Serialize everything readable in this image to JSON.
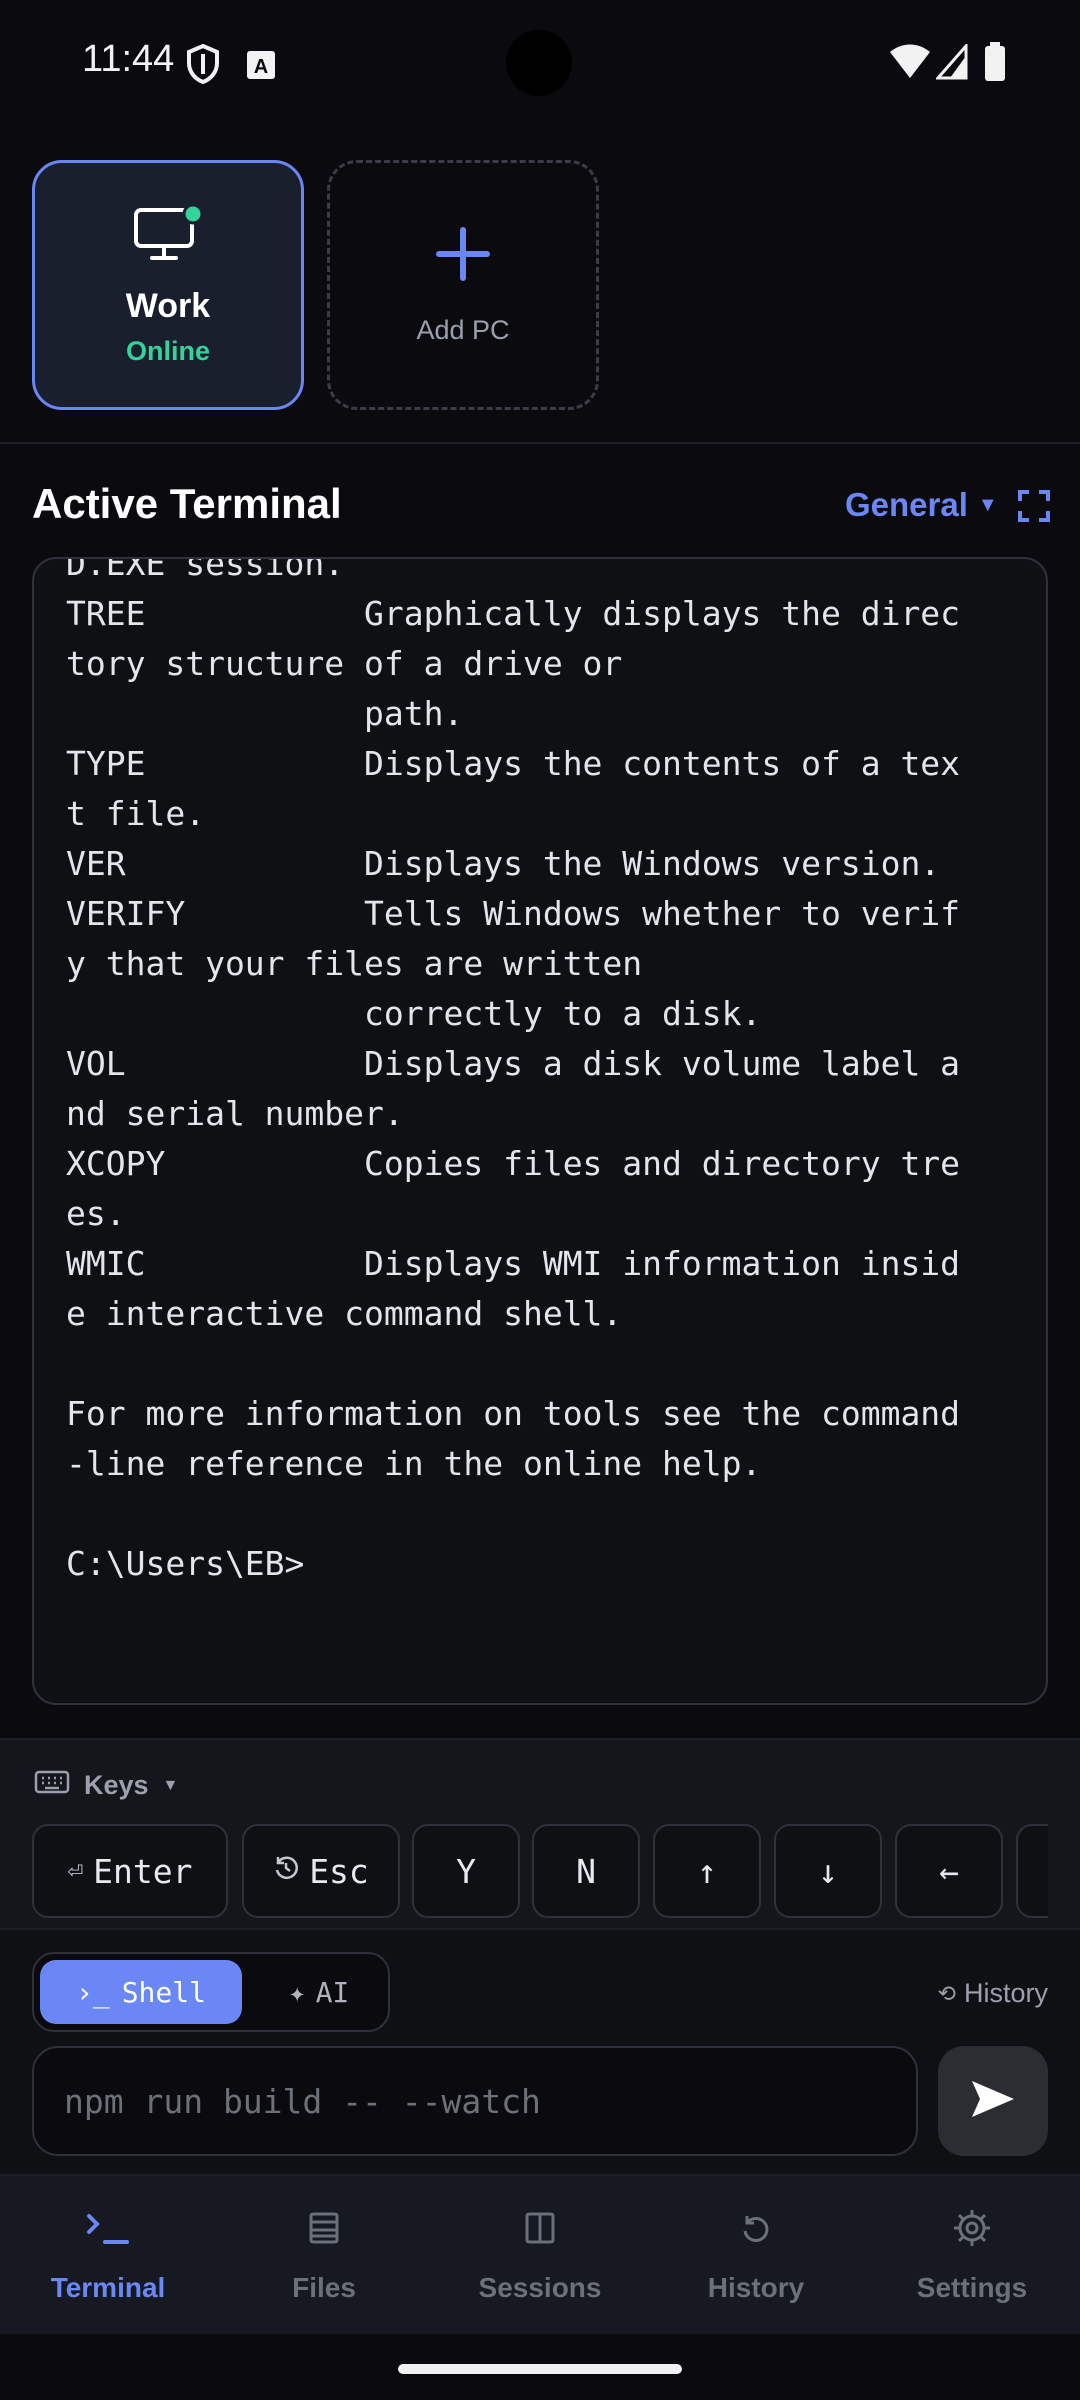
{
  "status_bar": {
    "time": "11:44"
  },
  "pcs": [
    {
      "name": "Work",
      "status": "Online"
    }
  ],
  "add_pc_label": "Add PC",
  "terminal": {
    "title": "Active Terminal",
    "profile": "General",
    "output": "D.EXE session.\nTREE           Graphically displays the direc\ntory structure of a drive or\n               path.\nTYPE           Displays the contents of a tex\nt file.\nVER            Displays the Windows version.\nVERIFY         Tells Windows whether to verif\ny that your files are written\n               correctly to a disk.\nVOL            Displays a disk volume label a\nnd serial number.\nXCOPY          Copies files and directory tre\nes.\nWMIC           Displays WMI information insid\ne interactive command shell.\n\nFor more information on tools see the command\n-line reference in the online help.\n\nC:\\Users\\EB>"
  },
  "keys": {
    "header": "Keys",
    "items": [
      {
        "label": "Enter",
        "icon": "return-icon"
      },
      {
        "label": "Esc",
        "icon": "escape-icon"
      },
      {
        "label": "Y"
      },
      {
        "label": "N"
      },
      {
        "label": "↑"
      },
      {
        "label": "↓"
      },
      {
        "label": "←"
      }
    ]
  },
  "mode": {
    "shell": "Shell",
    "ai": "AI",
    "active": "shell"
  },
  "history_link": "History",
  "command_input": {
    "placeholder": "npm run build -- --watch",
    "value": ""
  },
  "nav": [
    {
      "label": "Terminal",
      "icon": "terminal-icon",
      "active": true
    },
    {
      "label": "Files",
      "icon": "files-icon"
    },
    {
      "label": "Sessions",
      "icon": "sessions-icon"
    },
    {
      "label": "History",
      "icon": "history-icon"
    },
    {
      "label": "Settings",
      "icon": "settings-icon"
    }
  ],
  "colors": {
    "accent": "#6b87f5",
    "online": "#34d399",
    "background": "#0b0b0f"
  }
}
